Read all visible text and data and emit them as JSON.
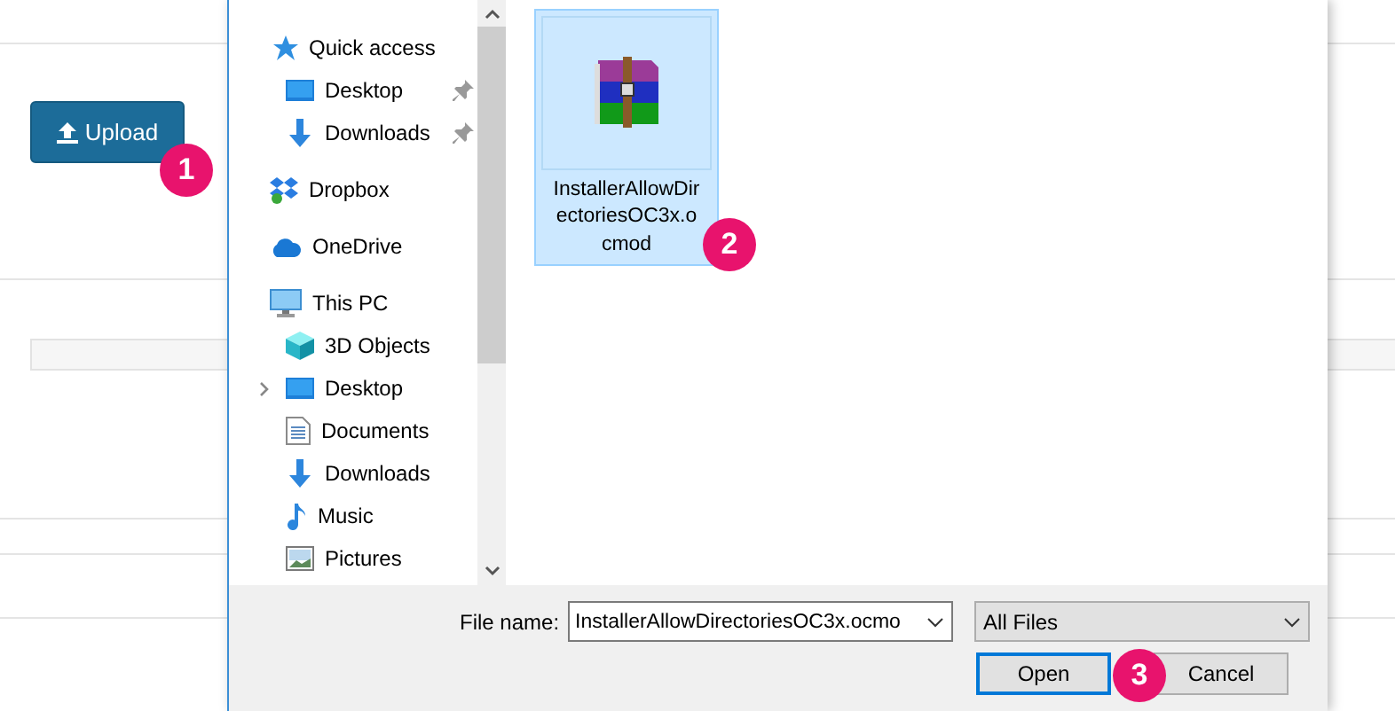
{
  "page": {
    "upload_button": "Upload"
  },
  "dialog": {
    "nav": [
      {
        "label": "Quick access",
        "kind": "star",
        "children": [
          {
            "label": "Desktop",
            "kind": "desktop",
            "pinned": true
          },
          {
            "label": "Downloads",
            "kind": "download",
            "pinned": true
          }
        ]
      },
      {
        "label": "Dropbox",
        "kind": "dropbox"
      },
      {
        "label": "OneDrive",
        "kind": "cloud"
      },
      {
        "label": "This PC",
        "kind": "pc",
        "children": [
          {
            "label": "3D Objects",
            "kind": "cube"
          },
          {
            "label": "Desktop",
            "kind": "desktop",
            "expanded": false
          },
          {
            "label": "Documents",
            "kind": "documents"
          },
          {
            "label": "Downloads",
            "kind": "download"
          },
          {
            "label": "Music",
            "kind": "music"
          },
          {
            "label": "Pictures",
            "kind": "pictures"
          }
        ]
      }
    ],
    "files": [
      {
        "name": "InstallerAllowDirectoriesOC3x.ocmod",
        "selected": true
      }
    ],
    "file_name_label": "File name:",
    "file_name_value": "InstallerAllowDirectoriesOC3x.ocmo",
    "file_type": "All Files",
    "buttons": [
      {
        "label": "Open",
        "default": true
      },
      {
        "label": "Cancel",
        "default": false
      }
    ]
  },
  "badges": [
    "1",
    "2",
    "3"
  ]
}
